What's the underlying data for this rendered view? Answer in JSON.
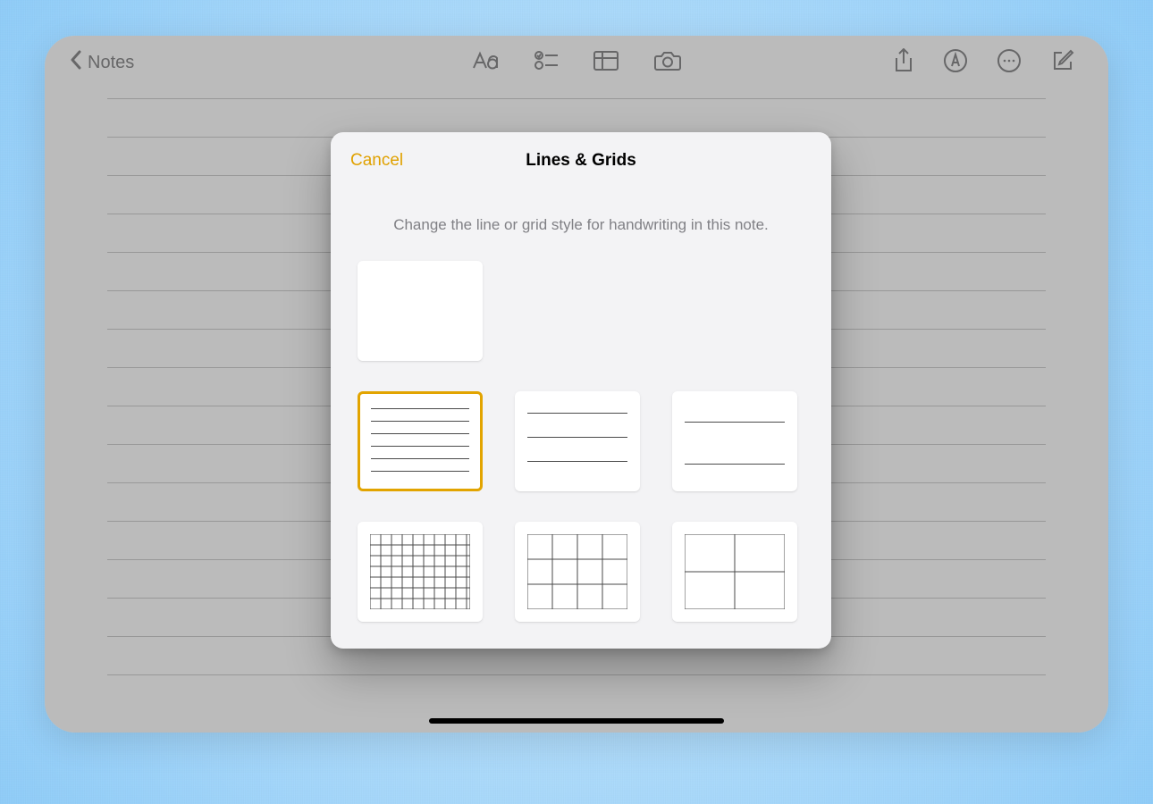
{
  "toolbar": {
    "back_label": "Notes"
  },
  "modal": {
    "cancel_label": "Cancel",
    "title": "Lines & Grids",
    "description": "Change the line or grid style for handwriting in this note.",
    "options": [
      {
        "id": "none",
        "selected": false
      },
      {
        "id": "lines-narrow",
        "selected": true
      },
      {
        "id": "lines-medium",
        "selected": false
      },
      {
        "id": "lines-wide",
        "selected": false
      },
      {
        "id": "grid-small",
        "selected": false
      },
      {
        "id": "grid-medium",
        "selected": false
      },
      {
        "id": "grid-large",
        "selected": false
      }
    ]
  },
  "colors": {
    "accent": "#e2a400"
  }
}
